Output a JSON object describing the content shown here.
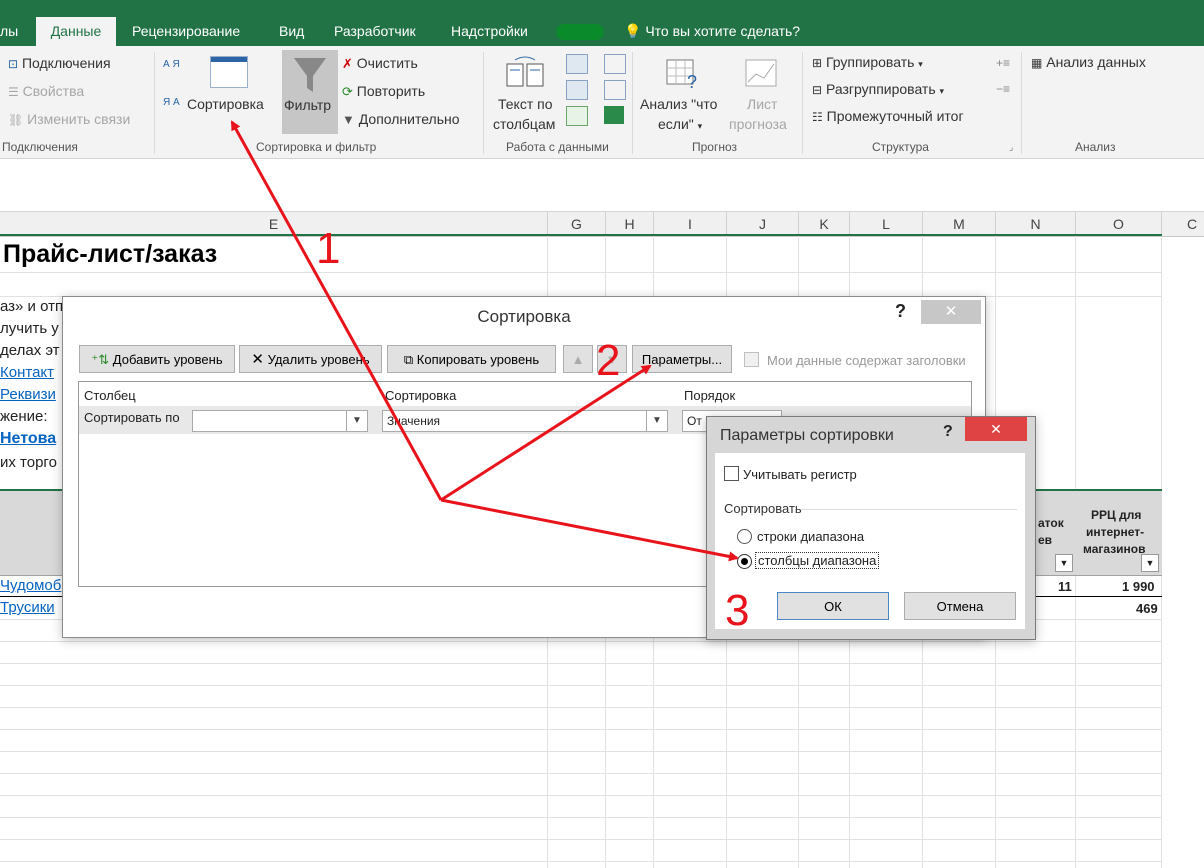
{
  "ribbon": {
    "tabs": [
      "лы",
      "Данные",
      "Рецензирование",
      "Вид",
      "Разработчик",
      "Надстройки",
      "Что вы хотите сделать?"
    ],
    "title_fragment": "",
    "connections": {
      "connections": "Подключения",
      "properties": "Свойства",
      "edit_links": "Изменить связи",
      "group": "Подключения"
    },
    "sort_filter": {
      "sort": "Сортировка",
      "filter": "Фильтр",
      "clear": "Очистить",
      "reapply": "Повторить",
      "advanced": "Дополнительно",
      "group": "Сортировка и фильтр",
      "az": "А Я",
      "za": "Я А"
    },
    "data_tools": {
      "text_to_columns_1": "Текст по",
      "text_to_columns_2": "столбцам",
      "group": "Работа с данными"
    },
    "forecast": {
      "what_if_1": "Анализ \"что",
      "what_if_2": "если\"",
      "sheet_1": "Лист",
      "sheet_2": "прогноза",
      "group": "Прогноз"
    },
    "outline": {
      "group_btn": "Группировать",
      "ungroup": "Разгруппировать",
      "subtotal": "Промежуточный итог",
      "group": "Структура"
    },
    "analysis": {
      "data_analysis": "Анализ данных",
      "group": "Анализ"
    }
  },
  "columns": [
    "E",
    "G",
    "H",
    "I",
    "J",
    "K",
    "L",
    "M",
    "N",
    "O",
    "C"
  ],
  "sheet": {
    "title": "Прайс-лист/заказ",
    "lines": [
      "аз» и отп",
      "лучить у",
      "делах эт",
      "жение:",
      "их торго"
    ],
    "links": [
      "Контакт",
      "Реквизи",
      "Нетова"
    ],
    "rows": [
      "Чудомоб",
      "Трусики"
    ],
    "header_n_1": "аток",
    "header_n_2": "ев",
    "header_o_1": "РРЦ для",
    "header_o_2": "интернет-",
    "header_o_3": "магазинов",
    "n_value": "11",
    "o_value_1": "1 990",
    "o_value_2": "469"
  },
  "sort_dialog": {
    "title": "Сортировка",
    "help": "?",
    "close": "✕",
    "add_level": "Добавить уровень",
    "delete_level": "Удалить уровень",
    "copy_level": "Копировать уровень",
    "options": "Параметры...",
    "has_headers": "Мои данные содержат заголовки",
    "col_header": "Столбец",
    "sort_header": "Сортировка",
    "order_header": "Порядок",
    "sort_by": "Сортировать по",
    "sort_on_value": "Значения",
    "order_value": "От"
  },
  "options_dialog": {
    "title": "Параметры сортировки",
    "help": "?",
    "close": "✕",
    "case_sensitive": "Учитывать регистр",
    "orientation_label": "Сортировать",
    "rows": "строки диапазона",
    "columns": "столбцы диапазона",
    "selected": "columns",
    "ok": "ОК",
    "cancel": "Отмена"
  },
  "annotations": [
    "1",
    "2",
    "3"
  ],
  "colors": {
    "excel_green": "#217346",
    "annotation_red": "#e8131b"
  }
}
